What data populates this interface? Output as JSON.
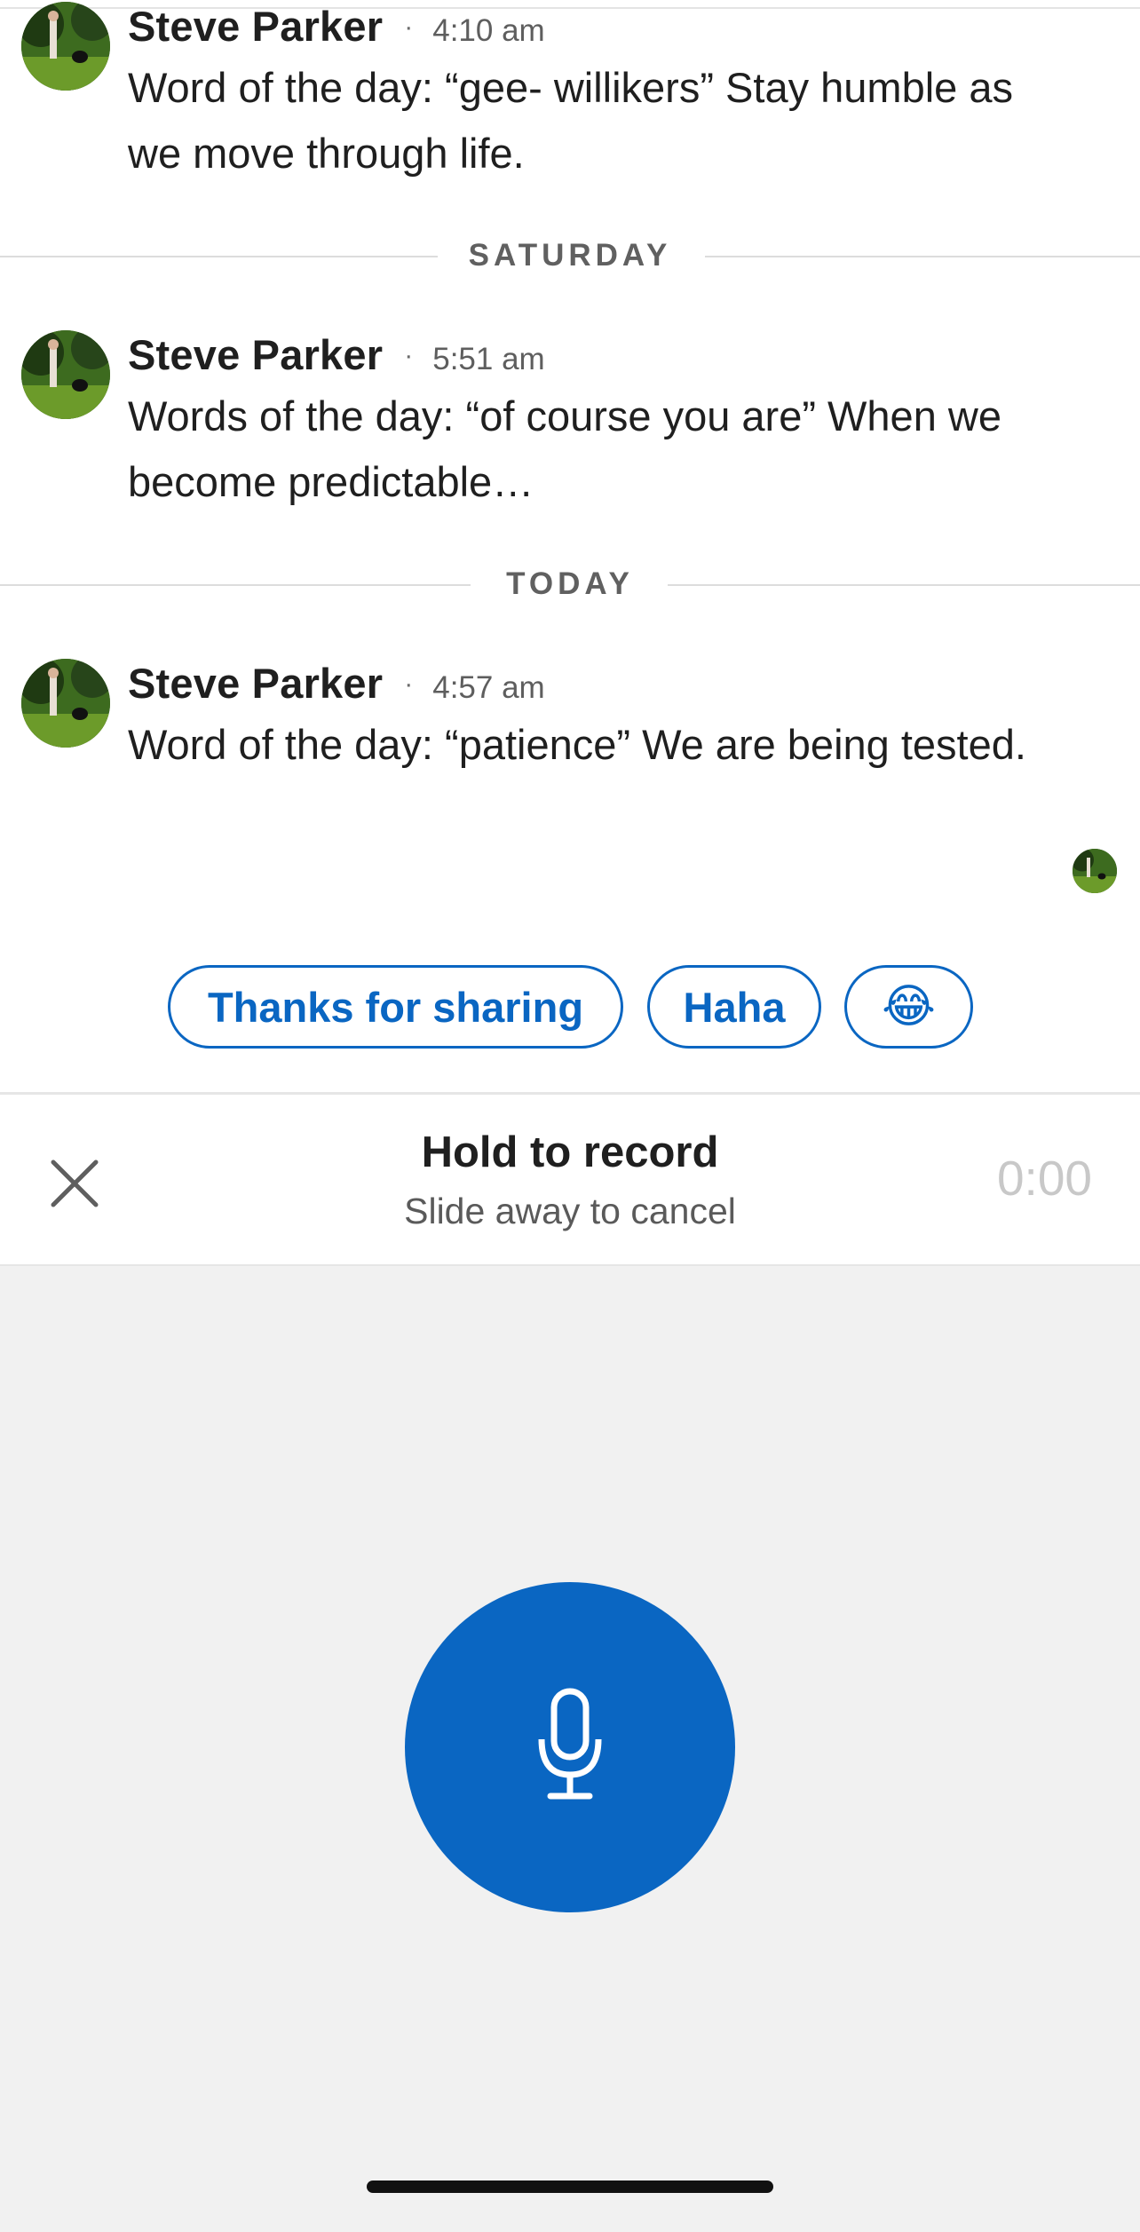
{
  "messages": [
    {
      "sender": "Steve Parker",
      "time": "4:10 am",
      "text": "Word of the day: “gee- willikers” Stay humble as we move through life."
    },
    {
      "sender": "Steve Parker",
      "time": "5:51 am",
      "text": "Words of the day: “of course you are” When we become predictable…"
    },
    {
      "sender": "Steve Parker",
      "time": "4:57 am",
      "text": "Word of the day: “patience” We are being tested."
    }
  ],
  "dividers": {
    "saturday": "SATURDAY",
    "today": "TODAY"
  },
  "separator": "·",
  "quick_replies": [
    "Thanks for sharing",
    "Haha",
    "😂"
  ],
  "recorder": {
    "title": "Hold to record",
    "subtitle": "Slide away to cancel",
    "timer": "0:00"
  },
  "colors": {
    "accent": "#0a66c2",
    "recorder_background": "#f1f1f1"
  },
  "icons": {
    "close": "close-icon",
    "microphone": "microphone-icon"
  }
}
